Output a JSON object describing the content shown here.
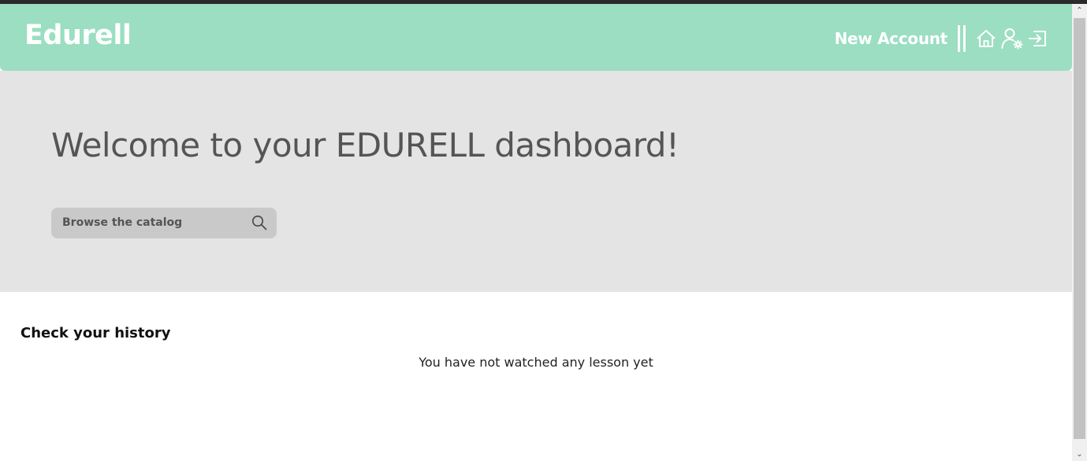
{
  "header": {
    "brand": "Edurell",
    "new_account_label": "New Account",
    "icons": [
      "home-icon",
      "user-settings-icon",
      "logout-icon"
    ],
    "background_color": "#9bdec2"
  },
  "hero": {
    "title": "Welcome to your EDURELL dashboard!",
    "search": {
      "label": "Browse the catalog",
      "icon": "search-icon"
    },
    "background_color": "#e4e4e4"
  },
  "history": {
    "title": "Check your history",
    "empty_message": "You have not watched any lesson yet"
  },
  "scrollbar": {
    "up_glyph": "⌃",
    "down_glyph": "⌄"
  }
}
